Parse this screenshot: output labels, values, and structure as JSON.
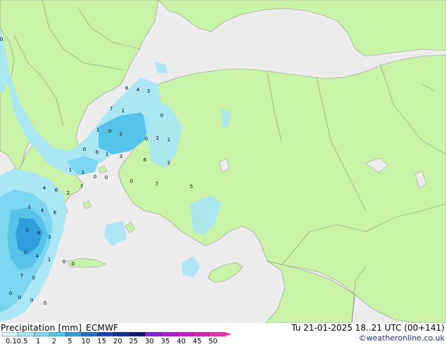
{
  "legend": {
    "product_label": "Precipitation [mm]",
    "model_label": "ECMWF",
    "run_label": "Tu 21-01-2025 18..21 UTC (00+141)",
    "credit": "©weatheronline.co.uk",
    "scale_levels": [
      "0.1",
      "0.5",
      "1",
      "2",
      "5",
      "10",
      "15",
      "20",
      "25",
      "30",
      "35",
      "40",
      "45",
      "50"
    ],
    "scale_colors": [
      "#d8f4fb",
      "#a8e6f6",
      "#7dd6f0",
      "#55c4ea",
      "#2f9fdc",
      "#1f6fd0",
      "#1c46b8",
      "#132c9a",
      "#0a1678",
      "#8a1fd6",
      "#b01ad8",
      "#d018d0",
      "#e21bbf",
      "#f02fae"
    ]
  },
  "colors": {
    "sea": "#ececec",
    "land": "#c9f3a6",
    "border": "#909090"
  },
  "map_labels": [
    "0",
    "8",
    "4",
    "3",
    "0",
    "1",
    "7",
    "1",
    "0",
    "2",
    "0",
    "0",
    "2",
    "1",
    "6",
    "1",
    "3",
    "6",
    "2",
    "1",
    "1",
    "0",
    "0",
    "0",
    "7",
    "4",
    "6",
    "2",
    "7",
    "5",
    "1",
    "4",
    "6",
    "3",
    "8",
    "3",
    "0",
    "4",
    "1",
    "0",
    "0",
    "7",
    "0",
    "0",
    "0",
    "0",
    "0"
  ]
}
